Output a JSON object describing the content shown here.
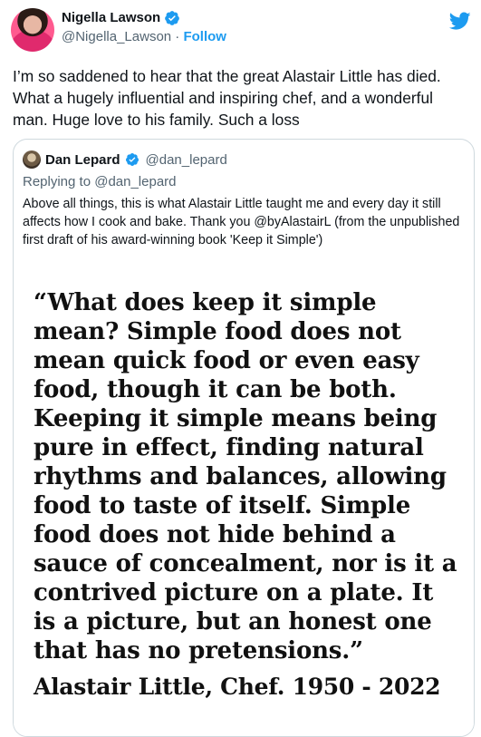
{
  "tweet": {
    "author_name": "Nigella Lawson",
    "handle": "@Nigella_Lawson",
    "separator": " · ",
    "follow_label": "Follow",
    "text": "I’m so saddened to hear that the great Alastair Little has died. What a hugely influential and inspiring chef, and a wonderful man. Huge love to his family. Such a loss"
  },
  "quoted_tweet": {
    "author_name": "Dan Lepard",
    "handle": "@dan_lepard",
    "replying_to": "Replying to @dan_lepard",
    "text": "Above all things, this is what Alastair Little taught me and every day it still affects how I cook and bake. Thank you @byAlastairL (from the unpublished first draft of his award-winning book 'Keep it Simple')",
    "image_quote": "“What does keep it simple\nmean?  Simple food does not\nmean quick food or even easy\nfood, though it can be both.\nKeeping it simple means being\npure in effect, finding natural\nrhythms and balances, allowing\nfood to taste of itself.  Simple\nfood does not hide behind a\nsauce of concealment, nor is it a\ncontrived picture on a plate.  It\nis a picture, but an honest one\nthat has no pretensions.”",
    "image_attribution": "Alastair Little, Chef. 1950 - 2022"
  },
  "icons": {
    "verified": "verified-badge-icon",
    "brand": "twitter-bird-icon"
  },
  "colors": {
    "accent": "#1d9bf0",
    "secondary_text": "#536471",
    "border": "#cfd9de"
  }
}
